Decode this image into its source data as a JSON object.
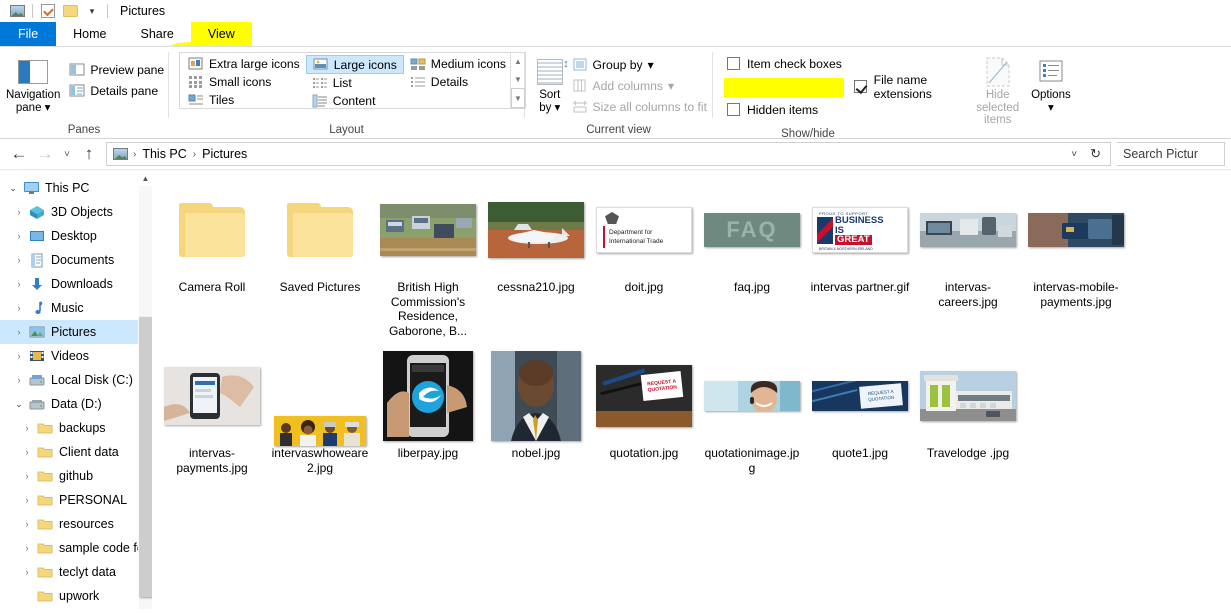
{
  "window": {
    "title": "Pictures",
    "quick_access": [
      "pictures-icon",
      "checkbox-icon",
      "folder-icon",
      "dropdown-caret"
    ]
  },
  "ribbon": {
    "tabs": [
      {
        "label": "File",
        "style": "file"
      },
      {
        "label": "Home",
        "style": "normal"
      },
      {
        "label": "Share",
        "style": "normal"
      },
      {
        "label": "View",
        "style": "highlighted"
      }
    ],
    "groups": {
      "panes": {
        "title": "Panes",
        "navigation_pane": "Navigation\npane",
        "navigation_pane_line1": "Navigation",
        "navigation_pane_line2": "pane",
        "preview_pane": "Preview pane",
        "details_pane": "Details pane"
      },
      "layout": {
        "title": "Layout",
        "items": [
          {
            "label": "Extra large icons",
            "selected": false
          },
          {
            "label": "Small icons",
            "selected": false
          },
          {
            "label": "Tiles",
            "selected": false
          },
          {
            "label": "Large icons",
            "selected": true
          },
          {
            "label": "List",
            "selected": false
          },
          {
            "label": "Content",
            "selected": false
          },
          {
            "label": "Medium icons",
            "selected": false
          },
          {
            "label": "Details",
            "selected": false
          }
        ]
      },
      "current_view": {
        "title": "Current view",
        "sort_by_line1": "Sort",
        "sort_by_line2": "by",
        "group_by": "Group by",
        "add_columns": "Add columns",
        "size_all_columns": "Size all columns to fit"
      },
      "show_hide": {
        "title": "Show/hide",
        "item_check_boxes": {
          "label": "Item check boxes",
          "checked": false,
          "highlighted": false
        },
        "file_name_extensions": {
          "label": "File name extensions",
          "checked": true,
          "highlighted": true
        },
        "hidden_items": {
          "label": "Hidden items",
          "checked": false,
          "highlighted": false
        },
        "hide_selected_line1": "Hide selected",
        "hide_selected_line2": "items",
        "options": "Options"
      }
    }
  },
  "address_bar": {
    "back": "←",
    "forward": "→",
    "recent": "˅",
    "up": "↑",
    "breadcrumbs": [
      "This PC",
      "Pictures"
    ],
    "dropdown": "˅",
    "refresh": "↻",
    "search_placeholder": "Search Pictur"
  },
  "sidebar": {
    "items": [
      {
        "label": "This PC",
        "icon": "monitor-icon",
        "caret": "open",
        "indent": 0,
        "selected": false
      },
      {
        "label": "3D Objects",
        "icon": "cube-icon",
        "caret": "closed",
        "indent": 1,
        "selected": false
      },
      {
        "label": "Desktop",
        "icon": "desktop-icon",
        "caret": "closed",
        "indent": 1,
        "selected": false
      },
      {
        "label": "Documents",
        "icon": "documents-icon",
        "caret": "closed",
        "indent": 1,
        "selected": false
      },
      {
        "label": "Downloads",
        "icon": "downloads-icon",
        "caret": "closed",
        "indent": 1,
        "selected": false
      },
      {
        "label": "Music",
        "icon": "music-icon",
        "caret": "closed",
        "indent": 1,
        "selected": false
      },
      {
        "label": "Pictures",
        "icon": "pictures-icon",
        "caret": "closed",
        "indent": 1,
        "selected": true
      },
      {
        "label": "Videos",
        "icon": "videos-icon",
        "caret": "closed",
        "indent": 1,
        "selected": false
      },
      {
        "label": "Local Disk  (C:)",
        "icon": "drive-icon",
        "caret": "closed",
        "indent": 1,
        "selected": false
      },
      {
        "label": "Data  (D:)",
        "icon": "drive-icon",
        "caret": "open",
        "indent": 1,
        "selected": false
      },
      {
        "label": "backups",
        "icon": "folder-icon",
        "caret": "closed",
        "indent": 2,
        "selected": false
      },
      {
        "label": "Client data",
        "icon": "folder-icon",
        "caret": "closed",
        "indent": 2,
        "selected": false
      },
      {
        "label": "github",
        "icon": "folder-icon",
        "caret": "closed",
        "indent": 2,
        "selected": false
      },
      {
        "label": "PERSONAL",
        "icon": "folder-icon",
        "caret": "closed",
        "indent": 2,
        "selected": false
      },
      {
        "label": "resources",
        "icon": "folder-icon",
        "caret": "closed",
        "indent": 2,
        "selected": false
      },
      {
        "label": "sample code fo",
        "icon": "folder-icon",
        "caret": "closed",
        "indent": 2,
        "selected": false
      },
      {
        "label": "teclyt data",
        "icon": "folder-icon",
        "caret": "closed",
        "indent": 2,
        "selected": false
      },
      {
        "label": "upwork",
        "icon": "folder-icon",
        "caret": "none",
        "indent": 2,
        "selected": false
      }
    ]
  },
  "files": [
    {
      "name": "Camera Roll",
      "type": "folder",
      "highlighted": false
    },
    {
      "name": "Saved Pictures",
      "type": "folder",
      "highlighted": false
    },
    {
      "name": "British High Commission's Residence, Gaborone, B...",
      "type": "image",
      "thumb": "aerial-landscape",
      "highlighted": false
    },
    {
      "name": "cessna210.jpg",
      "type": "image",
      "thumb": "cessna-plane",
      "highlighted": false
    },
    {
      "name": "doit.jpg",
      "type": "image",
      "thumb": "dept-international-trade",
      "highlighted": true
    },
    {
      "name": "faq.jpg",
      "type": "image",
      "thumb": "faq-letters",
      "highlighted": true
    },
    {
      "name": "intervas partner.gif",
      "type": "image",
      "thumb": "business-is-great",
      "highlighted": false
    },
    {
      "name": "intervas-careers.jpg",
      "type": "image",
      "thumb": "office-desk",
      "highlighted": false
    },
    {
      "name": "intervas-mobile-payments.jpg",
      "type": "image",
      "thumb": "card-payment",
      "highlighted": false
    },
    {
      "name": "intervas-payments.jpg",
      "type": "image",
      "thumb": "phone-in-hands",
      "highlighted": false
    },
    {
      "name": "intervaswhoweare2.jpg",
      "type": "image",
      "thumb": "people-yellow",
      "highlighted": false
    },
    {
      "name": "liberpay.jpg",
      "type": "image",
      "thumb": "phone-logo",
      "highlighted": false
    },
    {
      "name": "nobel.jpg",
      "type": "image",
      "thumb": "portrait-man",
      "highlighted": false
    },
    {
      "name": "quotation.jpg",
      "type": "image",
      "thumb": "quotation-desk",
      "highlighted": false
    },
    {
      "name": "quotationimage.jpg",
      "type": "image",
      "thumb": "headset-woman",
      "highlighted": false
    },
    {
      "name": "quote1.jpg",
      "type": "image",
      "thumb": "quote-card",
      "highlighted": false
    },
    {
      "name": "Travelodge .jpg",
      "type": "image",
      "thumb": "travelodge-building",
      "highlighted": false
    }
  ],
  "thumb_images": {
    "dept_international_trade_line1": "Department for",
    "dept_international_trade_line2": "International Trade",
    "faq_text": "FAQ",
    "business_line0": "PROUD TO SUPPORT",
    "business_line1": "BUSINESS",
    "business_line2": "IS",
    "business_line3": "GREAT",
    "business_line4": "BRITAIN & NORTHERN IRELAND",
    "quotation_card_line1": "REQUEST A",
    "quotation_card_line2": "QUOTATION"
  },
  "colors": {
    "accent": "#0078d7",
    "selection": "#cce8ff",
    "highlight": "#ffff00",
    "folder": "#f6d67c"
  }
}
